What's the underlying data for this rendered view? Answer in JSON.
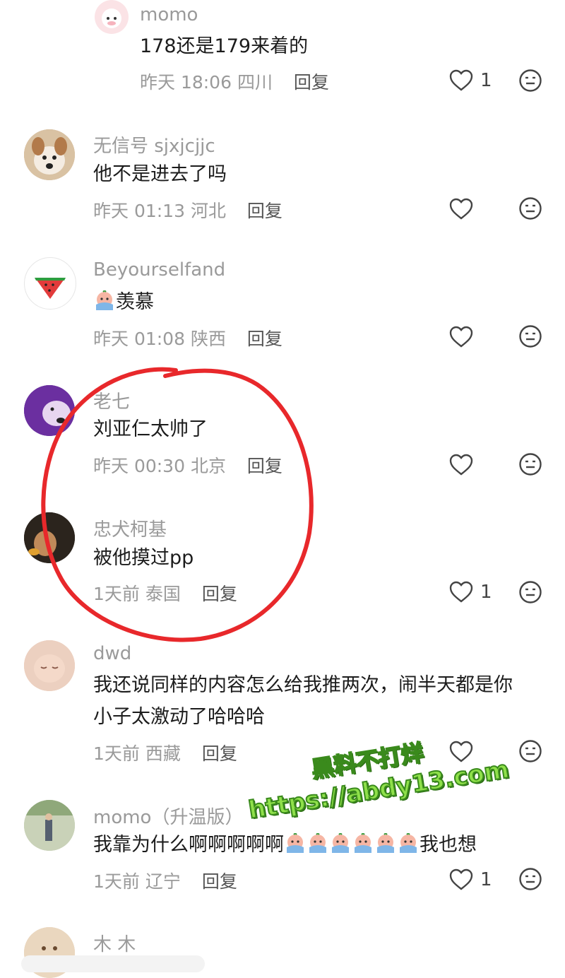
{
  "comments": [
    {
      "name": "momo",
      "text": "178还是179来着的",
      "time": "昨天 18:06",
      "region": "四川",
      "reply": "回复",
      "likes": "1"
    },
    {
      "name": "无信号 sjxjcjjc",
      "text": "他不是进去了吗",
      "time": "昨天 01:13",
      "region": "河北",
      "reply": "回复",
      "likes": ""
    },
    {
      "name": "Beyourselfand",
      "text": "羡慕",
      "time": "昨天 01:08",
      "region": "陕西",
      "reply": "回复",
      "likes": ""
    },
    {
      "name": "老七",
      "text": "刘亚仁太帅了",
      "time": "昨天 00:30",
      "region": "北京",
      "reply": "回复",
      "likes": ""
    },
    {
      "name": "忠犬柯基",
      "text": "被他摸过pp",
      "time": "1天前",
      "region": "泰国",
      "reply": "回复",
      "likes": "1"
    },
    {
      "name": "dwd",
      "text_line1": "我还说同样的内容怎么给我推两次，闹半天都是你",
      "text_line2": "小子太激动了哈哈哈",
      "time": "1天前",
      "region": "西藏",
      "reply": "回复",
      "likes": ""
    },
    {
      "name": "momo（升温版）",
      "text_before": "我靠为什么啊啊啊啊啊",
      "text_after": "我也想",
      "time": "1天前",
      "region": "辽宁",
      "reply": "回复",
      "likes": "1"
    },
    {
      "name": "木 木"
    }
  ],
  "watermark": {
    "line1": "黑料不打烊",
    "line2": "https://abdy13.com"
  },
  "colors": {
    "circle": "#e8282b",
    "watermark_fill": "#8fe04a",
    "meta": "#9a9a9a"
  }
}
